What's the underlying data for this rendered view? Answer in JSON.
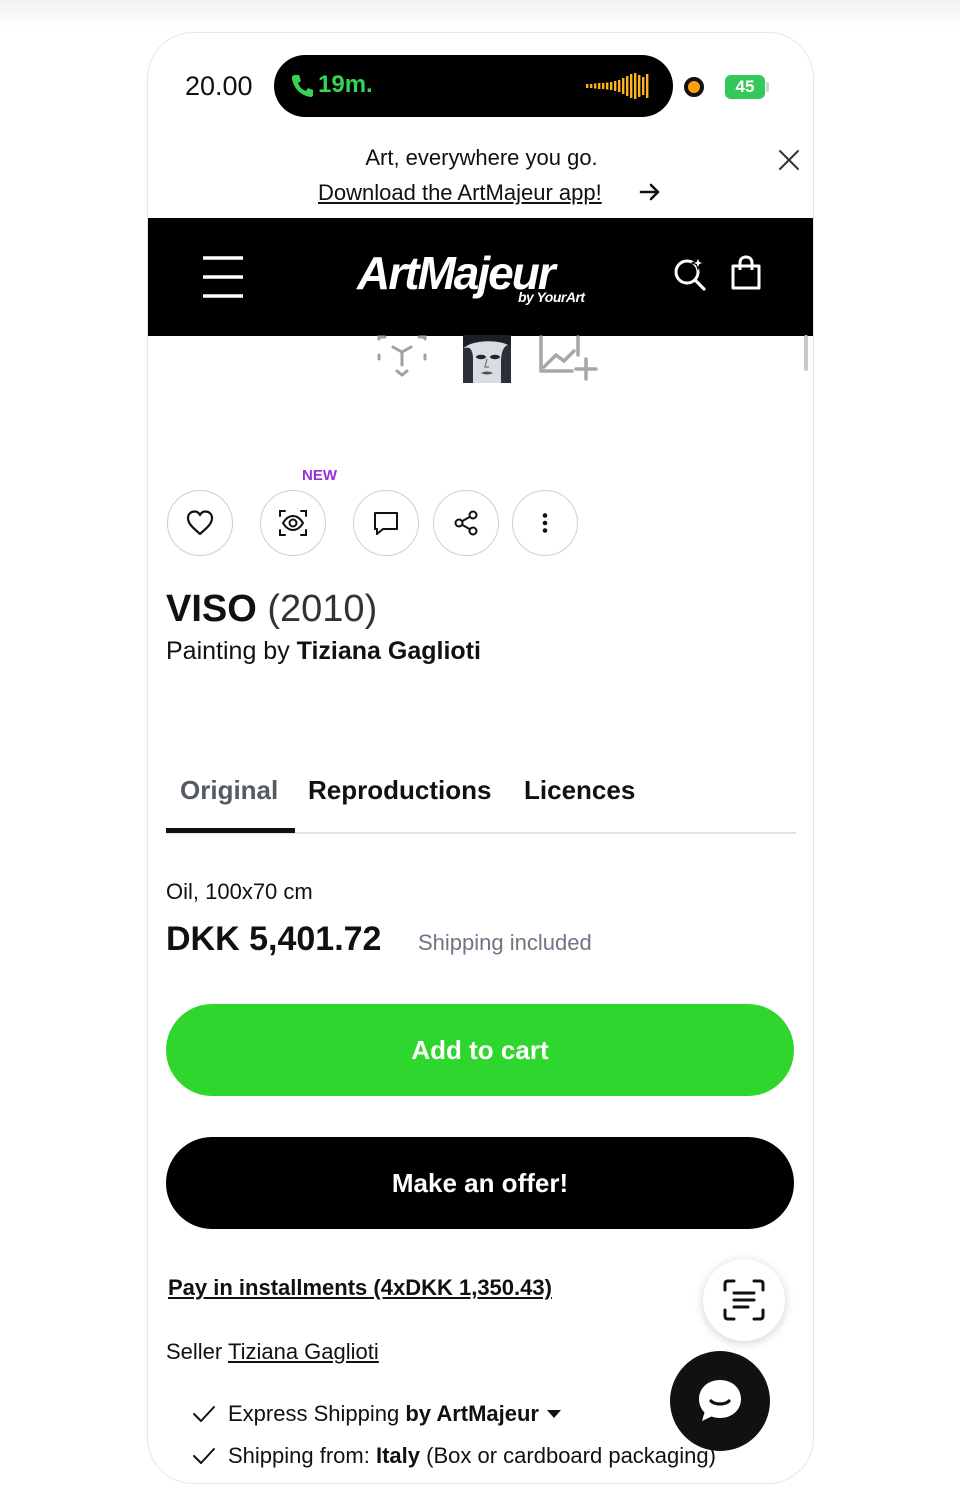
{
  "status_bar": {
    "time": "20.00",
    "call_duration": "19m.",
    "battery": "45"
  },
  "app_banner": {
    "tagline": "Art, everywhere you go.",
    "download_link": "Download the ArtMajeur app!"
  },
  "header": {
    "logo": "ArtMajeur",
    "logo_sub": "by YourArt"
  },
  "actions": {
    "new_badge": "NEW"
  },
  "artwork": {
    "title": "VISO",
    "year": "(2010)",
    "category_prefix": "Painting by",
    "artist": "Tiziana Gaglioti"
  },
  "tabs": [
    {
      "label": "Original",
      "active": true
    },
    {
      "label": "Reproductions",
      "active": false
    },
    {
      "label": "Licences",
      "active": false
    }
  ],
  "offer": {
    "medium": "Oil, 100x70 cm",
    "price": "DKK 5,401.72",
    "shipping_note": "Shipping included",
    "add_to_cart": "Add to cart",
    "make_offer": "Make an offer!",
    "installments": "Pay in installments (4xDKK 1,350.43)",
    "seller_label": "Seller",
    "seller_name": "Tiziana Gaglioti"
  },
  "shipping": {
    "row1_prefix": "Express Shipping",
    "row1_bold": "by ArtMajeur",
    "row2_label": "Shipping from:",
    "row2_bold": "Italy",
    "row2_suffix": "(Box or cardboard packaging)"
  },
  "colors": {
    "accent_green": "#2ed62e",
    "new_badge": "#9a2fd8",
    "header_bg": "#000000"
  }
}
